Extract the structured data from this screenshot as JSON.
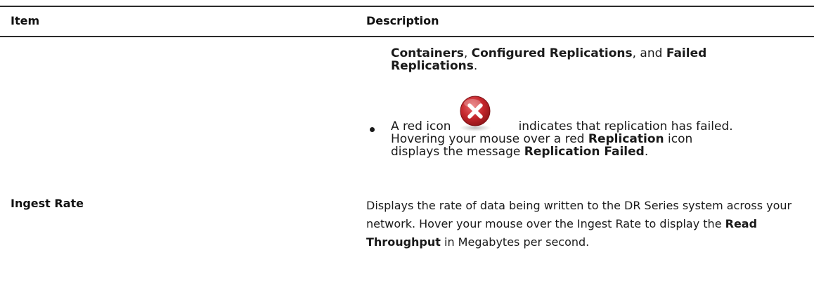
{
  "table": {
    "headers": {
      "item": "Item",
      "description": "Description"
    },
    "continuation": {
      "parts": [
        {
          "text": "Containers",
          "bold": true
        },
        {
          "text": ", ",
          "bold": false
        },
        {
          "text": "Configured Replications",
          "bold": true
        },
        {
          "text": ", and ",
          "bold": false
        },
        {
          "text": "Failed",
          "bold": true
        },
        {
          "text": "Replications",
          "bold": true
        },
        {
          "text": ".",
          "bold": false
        }
      ]
    },
    "bullet": {
      "pre_icon": "A red icon",
      "post_icon": "indicates that replication has failed.",
      "line2_pre": "Hovering your mouse over a red ",
      "line2_bold": "Replication",
      "line2_post": " icon",
      "line3_pre": "displays the message ",
      "line3_bold": "Replication Failed",
      "line3_post": ".",
      "icon": "red-failed-icon"
    },
    "rows": [
      {
        "item": "Ingest Rate",
        "desc_part1": "Displays the rate of data being written to the DR Series system across your network. Hover your mouse over the Ingest Rate to display the ",
        "desc_bold": "Read Throughput",
        "desc_part2": " in Megabytes per second."
      }
    ]
  },
  "colors": {
    "rule": "#2b2b2b",
    "text": "#1a1a1a",
    "icon_red": "#c0282d"
  }
}
